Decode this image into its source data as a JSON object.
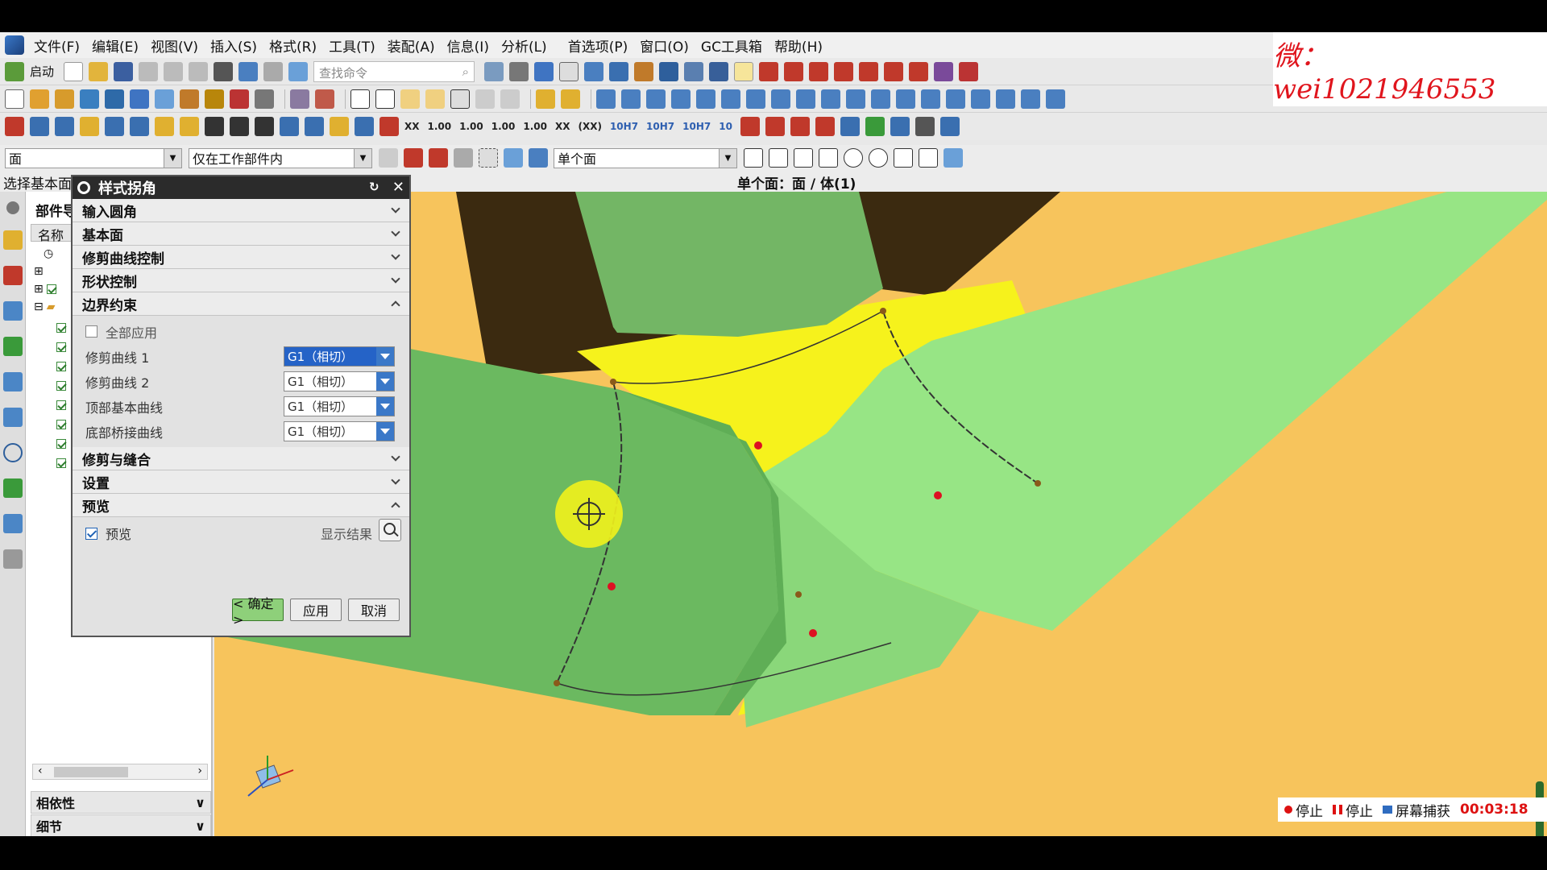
{
  "menu": [
    "文件(F)",
    "编辑(E)",
    "视图(V)",
    "插入(S)",
    "格式(R)",
    "工具(T)",
    "装配(A)",
    "信息(I)",
    "分析(L)",
    "首选项(P)",
    "窗口(O)",
    "GC工具箱",
    "帮助(H)"
  ],
  "watermark": "微：wei1021946553",
  "toolbar": {
    "start_label": "启动",
    "search_placeholder": "查找命令"
  },
  "number_toolbar": [
    "XX",
    "1.00",
    "1.00",
    "1.00",
    "1.00",
    "XX",
    "(XX)",
    "10H7",
    "10H7",
    "10H7",
    "10"
  ],
  "selection_bar": {
    "filter": "面",
    "scope": "仅在工作部件内",
    "face_rule": "单个面"
  },
  "cue": "选择基本面",
  "status": "单个面：面 / 体(1)",
  "navigator": {
    "title": "部件导",
    "column": "名称",
    "rows_visible": 8
  },
  "nav_sections": [
    "相依性",
    "细节",
    "预览"
  ],
  "dialog": {
    "title": "样式拐角",
    "sections_top": [
      "输入圆角",
      "基本面",
      "修剪曲线控制",
      "形状控制",
      "边界约束"
    ],
    "apply_all": "全部应用",
    "constraints": [
      {
        "label": "修剪曲线 1",
        "value": "G1（相切）"
      },
      {
        "label": "修剪曲线 2",
        "value": "G1（相切）"
      },
      {
        "label": "顶部基本曲线",
        "value": "G1（相切）"
      },
      {
        "label": "底部桥接曲线",
        "value": "G1（相切）"
      }
    ],
    "sections_mid": [
      "修剪与缝合",
      "设置",
      "预览"
    ],
    "preview_label": "预览",
    "show_result": "显示结果",
    "ok": "< 确定 >",
    "apply": "应用",
    "cancel": "取消"
  },
  "recorder": {
    "stop1": "停止",
    "stop2": "停止",
    "capture": "屏幕捕获",
    "time": "00:03:18"
  },
  "colors": {
    "background": "#f7c45c",
    "surface": "#8fd37a",
    "corner_patch": "#f6f21c",
    "dark": "#3b2a10"
  }
}
